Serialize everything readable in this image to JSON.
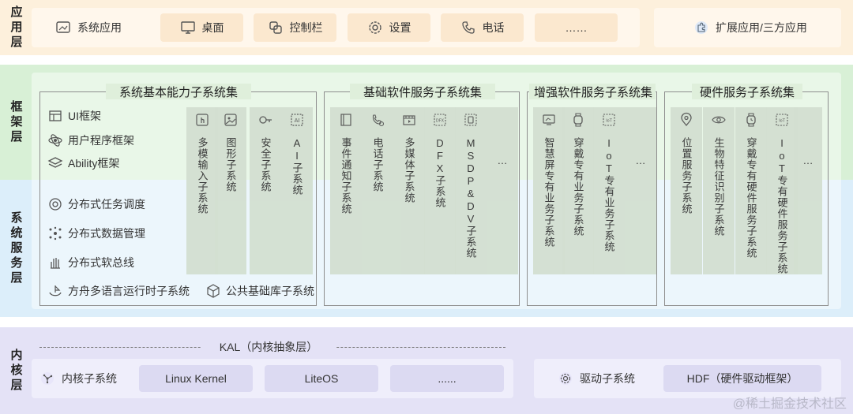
{
  "layers": {
    "app": "应用层",
    "framework": "框架层",
    "system": "系统服务层",
    "kernel": "内核层"
  },
  "app_layer": {
    "items": [
      "系统应用",
      "桌面",
      "控制栏",
      "设置",
      "电话",
      "……"
    ],
    "extension": "扩展应用/三方应用"
  },
  "framework_items": [
    "UI框架",
    "用户程序框架",
    "Ability框架"
  ],
  "system_items": [
    "分布式任务调度",
    "分布式数据管理",
    "分布式软总线"
  ],
  "bottom_items": [
    "方舟多语言运行时子系统",
    "公共基础库子系统"
  ],
  "groups": [
    {
      "title": "系统基本能力子系统集",
      "subsystems": [
        "多模输入子系统",
        "图形子系统",
        "安全子系统",
        "AI子系统"
      ]
    },
    {
      "title": "基础软件服务子系统集",
      "subsystems": [
        "事件通知子系统",
        "电话子系统",
        "多媒体子系统",
        "DFX子系统",
        "MSDP&DV子系统",
        "…"
      ]
    },
    {
      "title": "增强软件服务子系统集",
      "subsystems": [
        "智慧屏专有业务子系统",
        "穿戴专有业务子系统",
        "IoT专有业务子系统",
        "…"
      ]
    },
    {
      "title": "硬件服务子系统集",
      "subsystems": [
        "位置服务子系统",
        "生物特征识别子系统",
        "穿戴专有硬件服务子系统",
        "IoT专有硬件服务子系统",
        "…"
      ]
    }
  ],
  "kernel_layer": {
    "kal": "KAL（内核抽象层）",
    "items": [
      "内核子系统",
      "Linux Kernel",
      "LiteOS",
      "......"
    ],
    "driver": "驱动子系统",
    "hdf": "HDF（硬件驱动框架）"
  },
  "watermark": "@稀土掘金技术社区"
}
